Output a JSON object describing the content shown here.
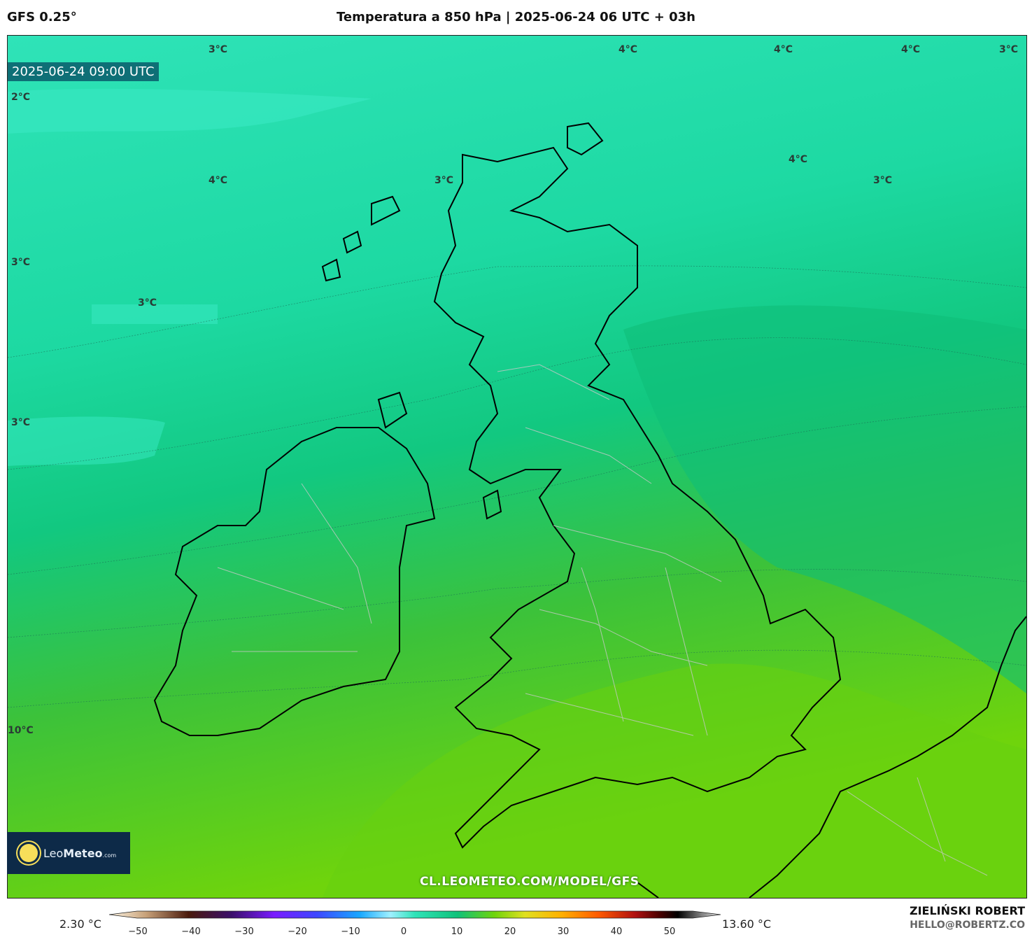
{
  "header": {
    "model": "GFS 0.25°",
    "title": "Temperatura a 850 hPa | 2025-06-24 06 UTC + 03h"
  },
  "map": {
    "valid_time": "2025-06-24 09:00 UTC",
    "isotherm_labels": [
      "3°C",
      "4°C",
      "4°C",
      "4°C",
      "3°C",
      "2°C",
      "4°C",
      "3°C",
      "4°C",
      "3°C",
      "3°C",
      "3°C",
      "3°C",
      "10°C"
    ],
    "source_url": "CL.LEOMETEO.COM/MODEL/GFS",
    "palette": {
      "cold": "#2fe3b8",
      "mid": "#10c27a",
      "warm": "#5ccf12",
      "warmest": "#7fd80a",
      "coast": "#000000",
      "borders": "#c8c8c8"
    }
  },
  "logo": {
    "brand_a": "Leo",
    "brand_b": "Meteo",
    "brand_c": ".com"
  },
  "colorbar": {
    "min_label": "2.30 °C",
    "max_label": "13.60 °C",
    "ticks": [
      "−50",
      "−40",
      "−30",
      "−20",
      "−10",
      "0",
      "10",
      "20",
      "30",
      "40",
      "50"
    ]
  },
  "credits": {
    "author": "ZIELIŃSKI ROBERT",
    "email": "HELLO@ROBERTZ.CO"
  }
}
